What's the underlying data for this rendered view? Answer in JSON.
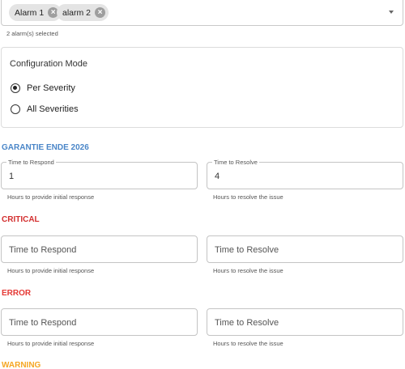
{
  "alarm_select": {
    "chips": [
      {
        "label": "Alarm 1"
      },
      {
        "label": "alarm 2"
      }
    ],
    "helper": "2 alarm(s) selected"
  },
  "config_mode": {
    "title": "Configuration Mode",
    "options": [
      {
        "label": "Per Severity",
        "checked": true
      },
      {
        "label": "All Severities",
        "checked": false
      }
    ]
  },
  "severities": [
    {
      "name": "GARANTIE ENDE 2026",
      "color": "#4a86c8",
      "respond": {
        "label": "Time to Respond",
        "value": "1",
        "helper": "Hours to provide initial response"
      },
      "resolve": {
        "label": "Time to Resolve",
        "value": "4",
        "helper": "Hours to resolve the issue"
      }
    },
    {
      "name": "CRITICAL",
      "color": "#d32f2f",
      "respond": {
        "label": "Time to Respond",
        "value": "",
        "helper": "Hours to provide initial response"
      },
      "resolve": {
        "label": "Time to Resolve",
        "value": "",
        "helper": "Hours to resolve the issue"
      }
    },
    {
      "name": "ERROR",
      "color": "#e53935",
      "respond": {
        "label": "Time to Respond",
        "value": "",
        "helper": "Hours to provide initial response"
      },
      "resolve": {
        "label": "Time to Resolve",
        "value": "",
        "helper": "Hours to resolve the issue"
      }
    },
    {
      "name": "WARNING",
      "color": "#f5a623"
    }
  ]
}
